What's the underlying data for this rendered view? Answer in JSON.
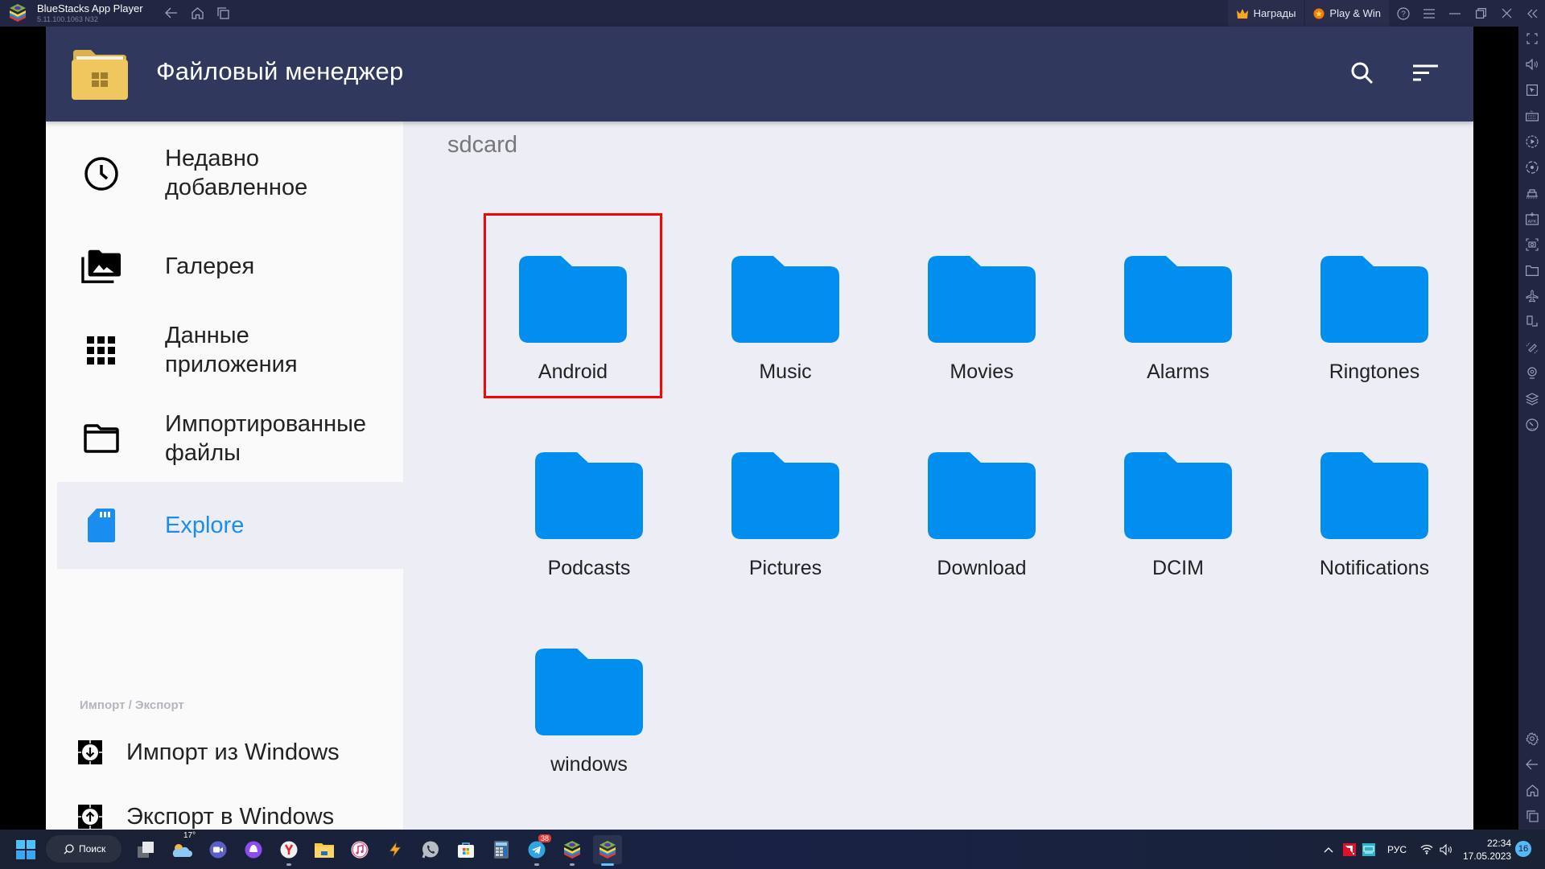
{
  "bluestacks": {
    "title": "BlueStacks App Player",
    "version": "5.11.100.1063 N32",
    "rewards_label": "Награды",
    "playwin_label": "Play & Win",
    "nav": [
      "back",
      "home",
      "recent-apps"
    ],
    "window_controls": [
      "help",
      "menu",
      "minimize",
      "restore",
      "close",
      "collapse-sidebar"
    ],
    "sidebar_top": [
      "fullscreen",
      "volume",
      "pointer",
      "keyboard-controls",
      "macro-recorder",
      "sync",
      "game-controls",
      "install-apk",
      "screenshot",
      "media-folder",
      "airplane-mode",
      "rotate",
      "shake",
      "location",
      "multi-instance",
      "eco-mode"
    ],
    "sidebar_bottom": [
      "settings",
      "back",
      "home",
      "recent-apps"
    ]
  },
  "app": {
    "title": "Файловый менеджер",
    "header_actions": [
      "search",
      "sort"
    ],
    "drawer": {
      "items": [
        {
          "label_line1": "Недавно",
          "label_line2": "добавленное",
          "icon": "clock-icon",
          "active": false
        },
        {
          "label_line1": "Галерея",
          "label_line2": "",
          "icon": "gallery-icon",
          "active": false
        },
        {
          "label_line1": "Данные",
          "label_line2": "приложения",
          "icon": "apps-grid-icon",
          "active": false
        },
        {
          "label_line1": "Импортированные",
          "label_line2": "файлы",
          "icon": "folder-outline-icon",
          "active": false
        },
        {
          "label_line1": "Explore",
          "label_line2": "",
          "icon": "sd-card-icon",
          "active": true
        }
      ],
      "section_label": "Импорт / Экспорт",
      "import_label": "Импорт из Windows",
      "export_label": "Экспорт в Windows"
    },
    "breadcrumb": "sdcard",
    "folders": [
      {
        "name": "Android",
        "selected": true
      },
      {
        "name": "Music",
        "selected": false
      },
      {
        "name": "Movies",
        "selected": false
      },
      {
        "name": "Alarms",
        "selected": false
      },
      {
        "name": "Ringtones",
        "selected": false
      },
      {
        "name": "Podcasts",
        "selected": false
      },
      {
        "name": "Pictures",
        "selected": false
      },
      {
        "name": "Download",
        "selected": false
      },
      {
        "name": "DCIM",
        "selected": false
      },
      {
        "name": "Notifications",
        "selected": false
      },
      {
        "name": "windows",
        "selected": false
      }
    ],
    "colors": {
      "header_bg": "#31385e",
      "folder": "#028eee",
      "accent": "#1a8ef0",
      "selection": "#ff0000"
    }
  },
  "taskbar": {
    "search_label": "Поиск",
    "weather_temp": "17°",
    "apps": [
      "task-view",
      "weather",
      "zoom-meet",
      "alice",
      "yandex-browser",
      "file-explorer",
      "itunes",
      "winamp",
      "whatsapp",
      "microsoft-store",
      "calculator",
      "telegram",
      "bluestacks-multi",
      "bluestacks"
    ],
    "telegram_badge": "38",
    "language": "РУС",
    "time": "22:34",
    "date": "17.05.2023",
    "notifications_count": "16"
  }
}
